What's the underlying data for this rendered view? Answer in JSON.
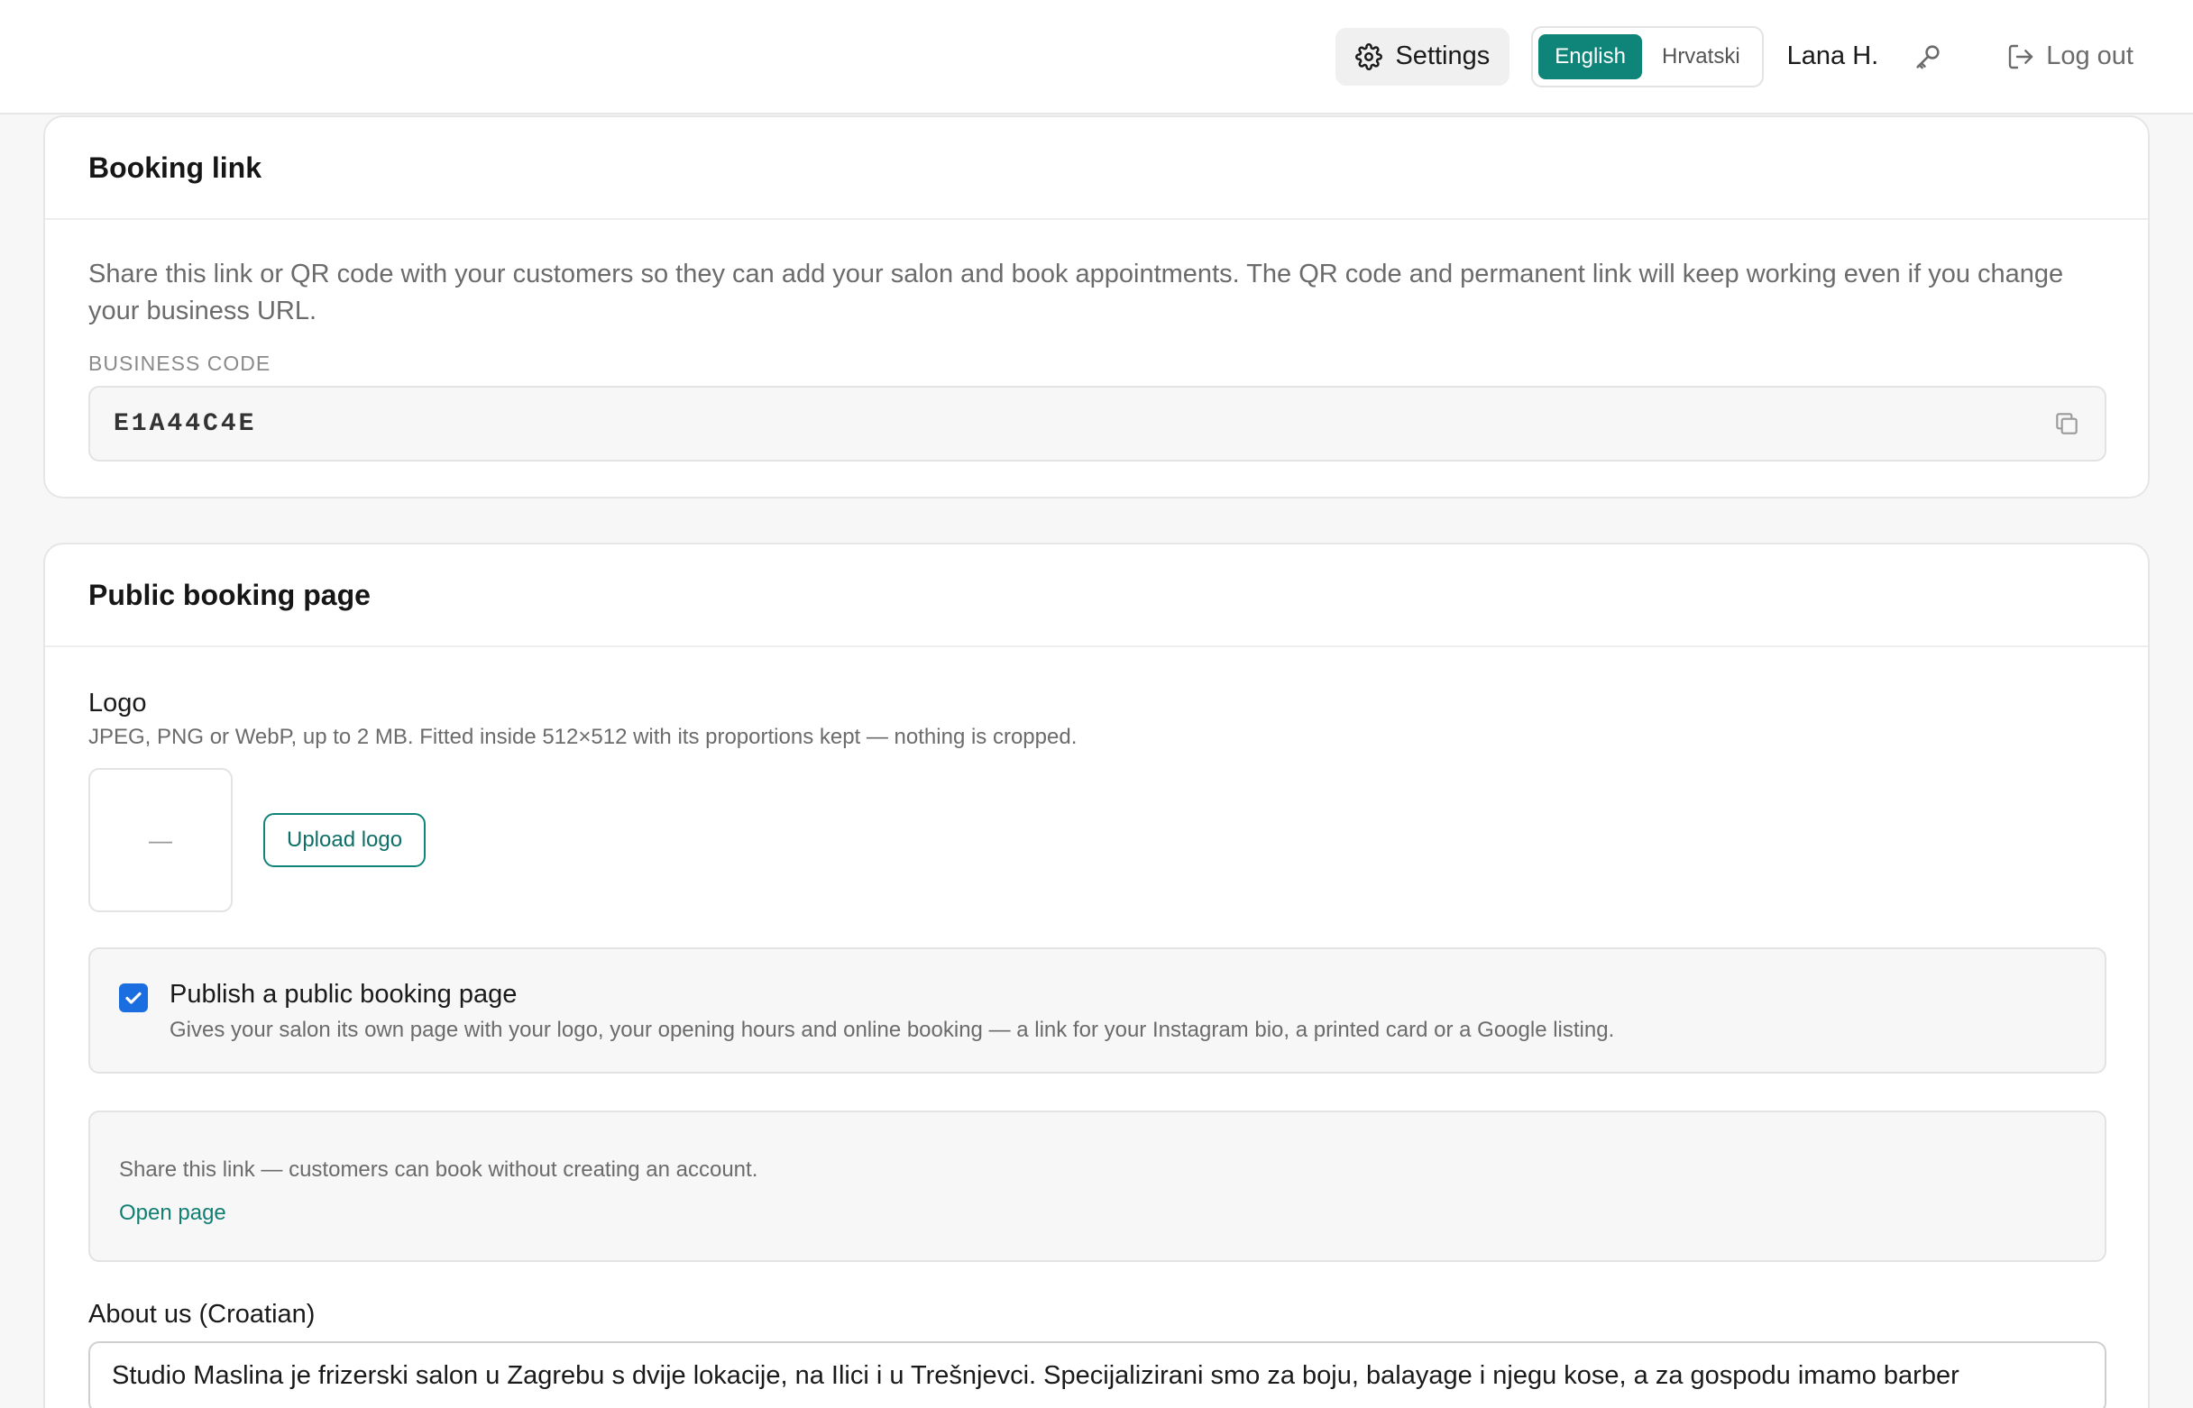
{
  "header": {
    "settings_label": "Settings",
    "languages": [
      "English",
      "Hrvatski"
    ],
    "active_language": "English",
    "user_name": "Lana H.",
    "logout_label": "Log out"
  },
  "booking_link": {
    "title": "Booking link",
    "description": "Share this link or QR code with your customers so they can add your salon and book appointments. The QR code and permanent link will keep working even if you change your business URL.",
    "code_label": "BUSINESS CODE",
    "code_value": "E1A44C4E"
  },
  "public_page": {
    "title": "Public booking page",
    "logo_label": "Logo",
    "logo_hint": "JPEG, PNG or WebP, up to 2 MB. Fitted inside 512×512 with its proportions kept — nothing is cropped.",
    "logo_placeholder": "—",
    "upload_label": "Upload logo",
    "publish_checked": true,
    "publish_label": "Publish a public booking page",
    "publish_desc": "Gives your salon its own page with your logo, your opening hours and online booking — a link for your Instagram bio, a printed card or a Google listing.",
    "share_text": "Share this link — customers can book without creating an account.",
    "open_page_label": "Open page",
    "about_label": "About us (Croatian)",
    "about_value": "Studio Maslina je frizerski salon u Zagrebu s dvije lokacije, na Ilici i u Trešnjevci. Specijalizirani smo za boju, balayage i njegu kose, a za gospodu imamo barber"
  },
  "colors": {
    "accent": "#0f8478",
    "checkbox": "#1a6ee0"
  }
}
